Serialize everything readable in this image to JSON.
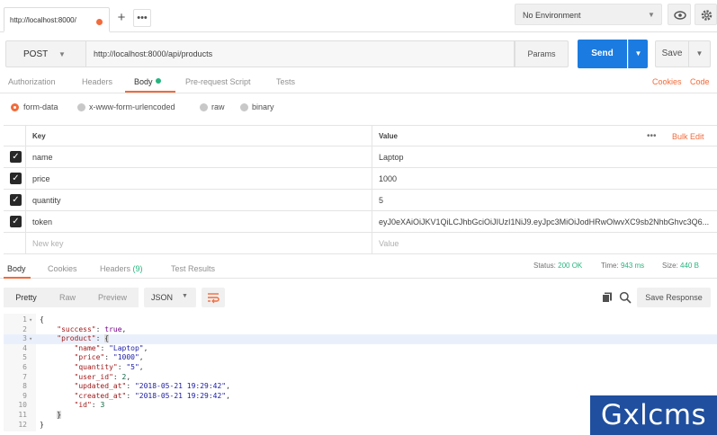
{
  "tab": {
    "label": "http://localhost:8000/"
  },
  "environment": {
    "selected": "No Environment"
  },
  "request": {
    "method": "POST",
    "url": "http://localhost:8000/api/products",
    "params_label": "Params",
    "send_label": "Send",
    "save_label": "Save"
  },
  "request_tabs": [
    "Authorization",
    "Headers",
    "Body",
    "Pre-request Script",
    "Tests"
  ],
  "request_links": [
    "Cookies",
    "Code"
  ],
  "body_types": [
    "form-data",
    "x-www-form-urlencoded",
    "raw",
    "binary"
  ],
  "params": {
    "key_header": "Key",
    "value_header": "Value",
    "more": "•••",
    "bulk_edit": "Bulk Edit",
    "rows": [
      {
        "key": "name",
        "value": "Laptop"
      },
      {
        "key": "price",
        "value": "1000"
      },
      {
        "key": "quantity",
        "value": "5"
      },
      {
        "key": "token",
        "value": "eyJ0eXAiOiJKV1QiLCJhbGciOiJIUzI1NiJ9.eyJpc3MiOiJodHRwOlwvXC9sb2NhbGhvc3Q6..."
      }
    ],
    "new_key_placeholder": "New key",
    "new_value_placeholder": "Value"
  },
  "response_tabs": {
    "body": "Body",
    "cookies": "Cookies",
    "headers": "Headers",
    "headers_count": "(9)",
    "test_results": "Test Results"
  },
  "response_meta": {
    "status_label": "Status:",
    "status_value": "200 OK",
    "time_label": "Time:",
    "time_value": "943 ms",
    "size_label": "Size:",
    "size_value": "440 B"
  },
  "response_toolbar": {
    "pretty": "Pretty",
    "raw": "Raw",
    "preview": "Preview",
    "format": "JSON",
    "save_response": "Save Response"
  },
  "code_lines": [
    {
      "n": "1",
      "fold": "▾",
      "html": "{"
    },
    {
      "n": "2",
      "fold": "",
      "html": "    <span class='k'>\"success\"</span>: <span class='b'>true</span>,"
    },
    {
      "n": "3",
      "fold": "▾",
      "html": "    <span class='k'>\"product\"</span>: <span class='brk'>{</span>",
      "hl": true
    },
    {
      "n": "4",
      "fold": "",
      "html": "        <span class='k'>\"name\"</span>: <span class='s'>\"Laptop\"</span>,"
    },
    {
      "n": "5",
      "fold": "",
      "html": "        <span class='k'>\"price\"</span>: <span class='s'>\"1000\"</span>,"
    },
    {
      "n": "6",
      "fold": "",
      "html": "        <span class='k'>\"quantity\"</span>: <span class='s'>\"5\"</span>,"
    },
    {
      "n": "7",
      "fold": "",
      "html": "        <span class='k'>\"user_id\"</span>: <span class='n'>2</span>,"
    },
    {
      "n": "8",
      "fold": "",
      "html": "        <span class='k'>\"updated_at\"</span>: <span class='s'>\"2018-05-21 19:29:42\"</span>,"
    },
    {
      "n": "9",
      "fold": "",
      "html": "        <span class='k'>\"created_at\"</span>: <span class='s'>\"2018-05-21 19:29:42\"</span>,"
    },
    {
      "n": "10",
      "fold": "",
      "html": "        <span class='k'>\"id\"</span>: <span class='n'>3</span>"
    },
    {
      "n": "11",
      "fold": "",
      "html": "    <span class='brk'>}</span>"
    },
    {
      "n": "12",
      "fold": "",
      "html": "}"
    }
  ],
  "watermark": "Gxlcms",
  "colors": {
    "accent": "#f26b3a",
    "primary": "#1b7be0",
    "success": "#26b47f"
  }
}
